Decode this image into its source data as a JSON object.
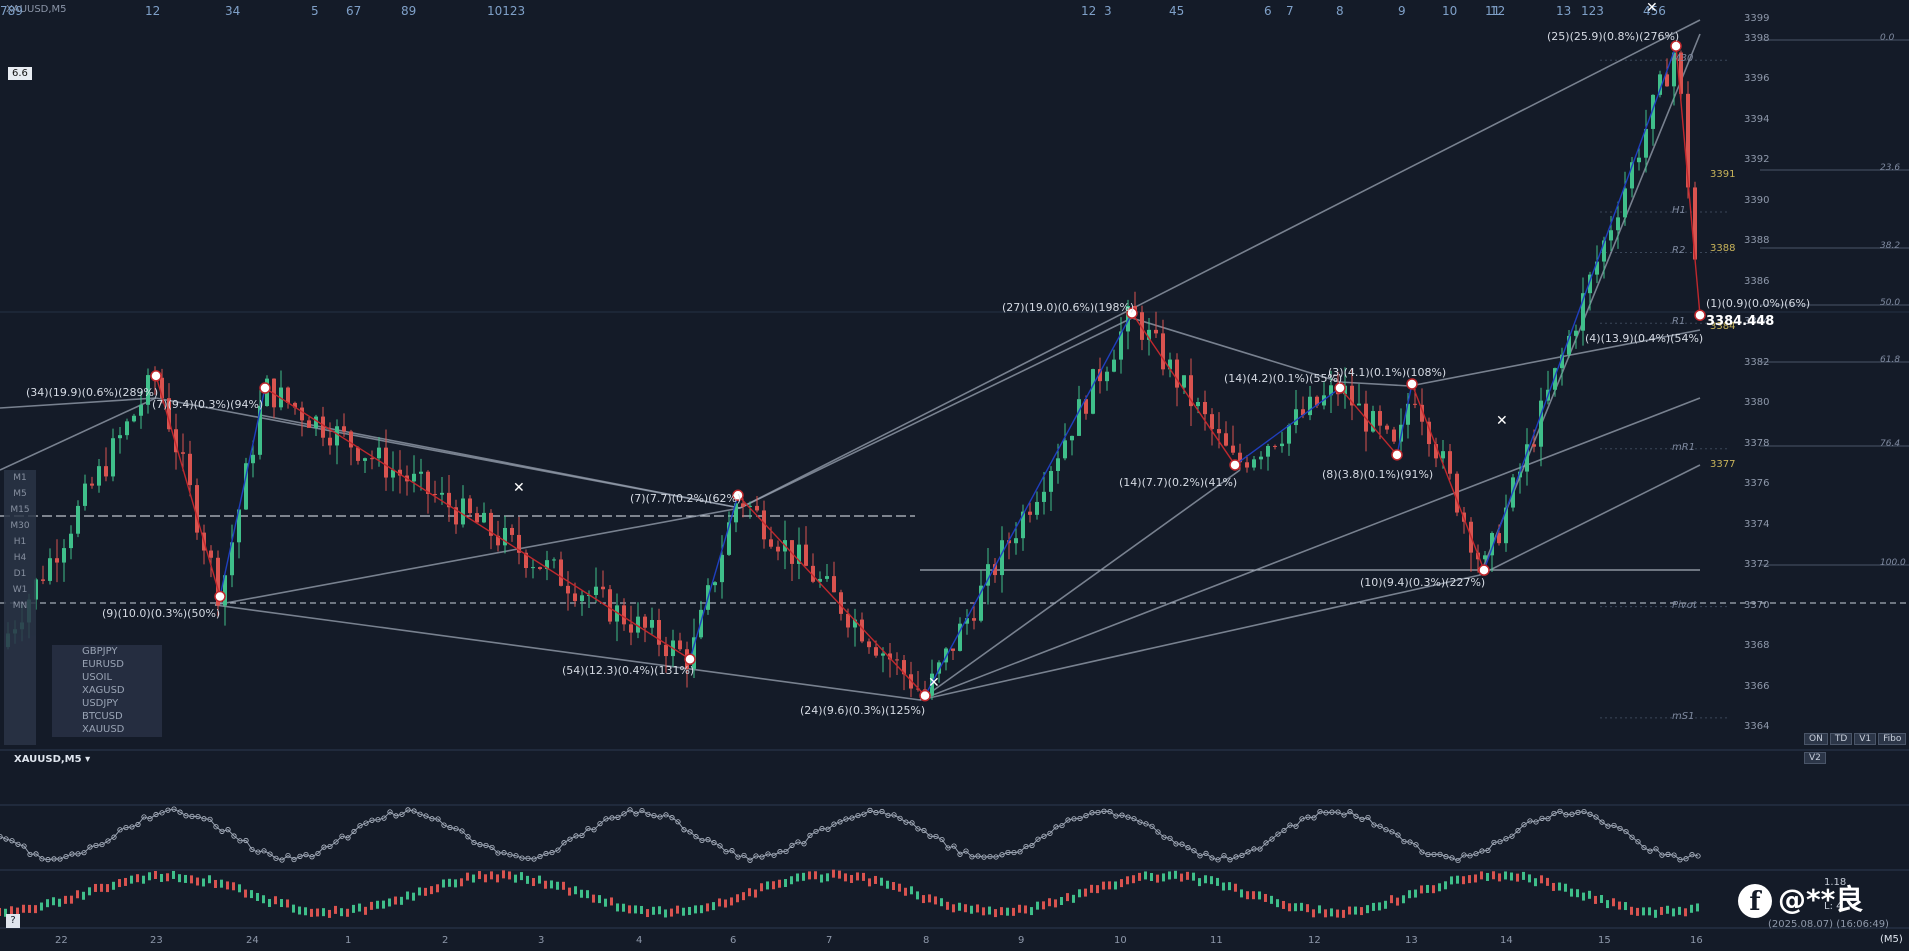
{
  "app": {
    "symbol_title": "XAUUSD,M5",
    "scale_badge": "6.6",
    "last_price": "3384.448",
    "timestamp": "(2025.08.07) (16:06:49)",
    "timeframe_corner": "(M5)",
    "subwindow_title": "XAUUSD,M5 ▾",
    "watermark_text": "@**良",
    "facebook_glyph": "f"
  },
  "colors": {
    "background": "#141b28",
    "bull_candle": "#3fbf8a",
    "bear_candle": "#d9534f",
    "wave_up": "#1f3fbf",
    "wave_down": "#c0282d",
    "channel": "#9aa3b2"
  },
  "price_axis": [
    "3399",
    "3398",
    "3396",
    "3394",
    "3392",
    "3390",
    "3388",
    "3386",
    "3384",
    "3382",
    "3380",
    "3378",
    "3376",
    "3374",
    "3372",
    "3370",
    "3368",
    "3366",
    "3364"
  ],
  "side_levels": [
    {
      "label": "M30",
      "price": "3397"
    },
    {
      "label": "H1",
      "price": "3389.5"
    },
    {
      "label": "R2",
      "price": "3387.5"
    },
    {
      "label": "R1",
      "price": "3384"
    },
    {
      "label": "mR1",
      "price": "3377.8"
    },
    {
      "label": "Pivot",
      "price": "3370"
    },
    {
      "label": "mS1",
      "price": "3364.5"
    }
  ],
  "fib_levels": [
    "0.0",
    "23.6",
    "38.2",
    "50.0",
    "61.8",
    "76.4",
    "100.0"
  ],
  "side_prices": [
    "3391",
    "3388",
    "3384",
    "3377"
  ],
  "wave_labels": [
    "(34)(19.9)(0.6%)(289%)",
    "(7)(9.4)(0.3%)(94%)",
    "(9)(10.0)(0.3%)(50%)",
    "(54)(12.3)(0.4%)(131%)",
    "(7)(7.7)(0.2%)(62%)",
    "(24)(9.6)(0.3%)(125%)",
    "(27)(19.0)(0.6%)(198%)",
    "(14)(7.7)(0.2%)(41%)",
    "(14)(4.2)(0.1%)(55%)",
    "(3)(4.1)(0.1%)(108%)",
    "(8)(3.8)(0.1%)(91%)",
    "(10)(9.4)(0.3%)(227%)",
    "(25)(25.9)(0.8%)(276%)",
    "(1)(0.9)(0.0%)(6%)",
    "(4)(13.9)(0.4%)(54%)"
  ],
  "timeframes": [
    "M1",
    "M5",
    "M15",
    "M30",
    "H1",
    "H4",
    "D1",
    "W1",
    "MN"
  ],
  "symbols": [
    "GBPJPY",
    "EURUSD",
    "USOIL",
    "XAGUSD",
    "USDJPY",
    "BTCUSD",
    "XAUUSD"
  ],
  "corner_buttons": [
    "ON",
    "TD",
    "V1",
    "Fibo",
    "V2"
  ],
  "dates": [
    "22",
    "23",
    "24",
    "1",
    "2",
    "3",
    "4",
    "6",
    "7",
    "8",
    "9",
    "10",
    "11",
    "12",
    "13",
    "14",
    "15",
    "16"
  ],
  "top_counts": [
    "12",
    "34",
    "5",
    "67",
    "89",
    "10123",
    "12",
    "3",
    "45",
    "6",
    "7",
    "8",
    "9",
    "10",
    "11",
    "12",
    "13",
    "123",
    "456",
    "789"
  ],
  "osc_values": [
    "1.18",
    "L: 4"
  ]
}
